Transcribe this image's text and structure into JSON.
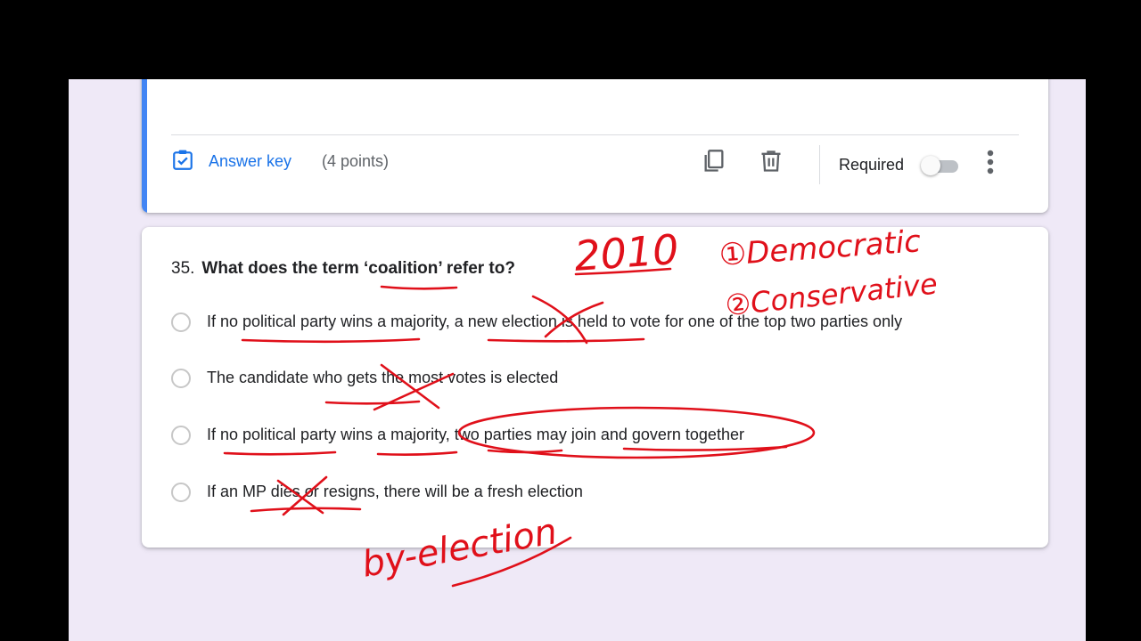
{
  "previous_card": {
    "answer_key_label": "Answer key",
    "points_label": "(4 points)",
    "required_label": "Required",
    "required_on": false
  },
  "question": {
    "number": "35.",
    "text": "What does the term ‘coalition’ refer to?",
    "options": [
      "If no political party wins a majority, a new election is held to vote for one of the top two parties only",
      "The candidate who gets the most votes is elected",
      "If no political party wins a majority, two parties may join and govern together",
      "If an MP dies or resigns, there will be a fresh election"
    ]
  },
  "annotations": {
    "year": "2010",
    "party_1": "①Democratic",
    "party_2": "②Conservative",
    "note": "by-election"
  },
  "colors": {
    "accent": "#4285f4",
    "link": "#1a73e8",
    "ink": "#e0101a",
    "background": "#efe9f7"
  }
}
